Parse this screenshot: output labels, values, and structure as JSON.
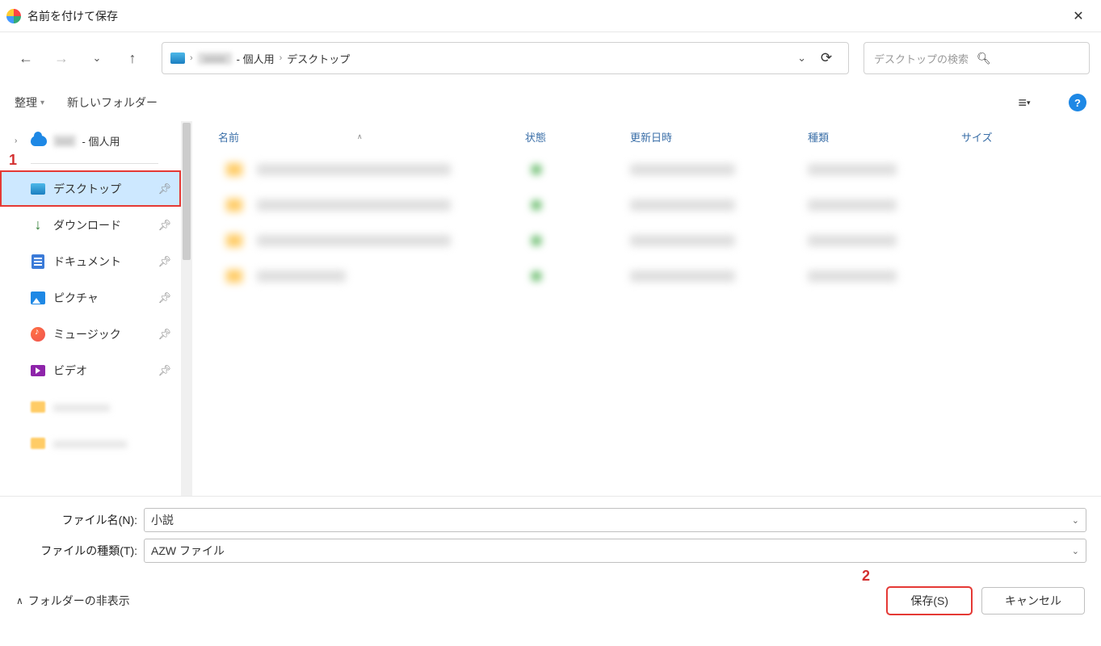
{
  "window": {
    "title": "名前を付けて保存"
  },
  "breadcrumb": {
    "personal_suffix": " - 個人用",
    "current": "デスクトップ"
  },
  "search": {
    "placeholder": "デスクトップの検索"
  },
  "toolbar": {
    "organize": "整理",
    "new_folder": "新しいフォルダー"
  },
  "tree": {
    "personal_suffix": " - 個人用"
  },
  "quick": {
    "desktop": "デスクトップ",
    "downloads": "ダウンロード",
    "documents": "ドキュメント",
    "pictures": "ピクチャ",
    "music": "ミュージック",
    "videos": "ビデオ"
  },
  "columns": {
    "name": "名前",
    "state": "状態",
    "modified": "更新日時",
    "type": "種類",
    "size": "サイズ"
  },
  "form": {
    "filename_label": "ファイル名(N):",
    "filename_value": "小説",
    "filetype_label": "ファイルの種類(T):",
    "filetype_value": "AZW ファイル"
  },
  "footer": {
    "hide_folders": "フォルダーの非表示",
    "save": "保存(S)",
    "cancel": "キャンセル"
  },
  "annotations": {
    "one": "1",
    "two": "2"
  }
}
